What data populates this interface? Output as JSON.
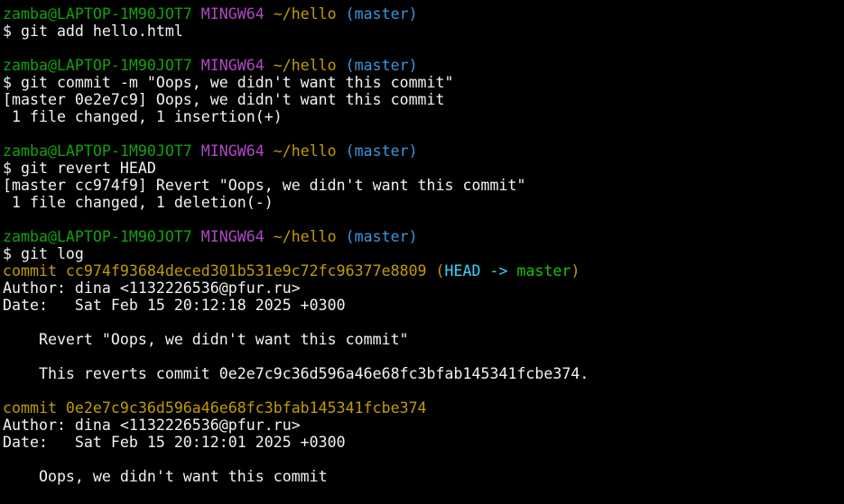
{
  "colors": {
    "background": "#000000",
    "text": "#f2f2f2",
    "prompt_user": "#13a10e",
    "prompt_msys": "#b148c6",
    "prompt_path": "#c19c00",
    "prompt_branch": "#3a96dd",
    "commit_hash": "#c19c00",
    "head_ref": "#3ad5ff",
    "branch_ref": "#16c60c"
  },
  "lines": [
    {
      "type": "prompt",
      "user": "zamba@LAPTOP-1M90JOT7",
      "msys": "MINGW64",
      "path": "~/hello",
      "branch": "(master)"
    },
    {
      "type": "command",
      "text": "$ git add hello.html"
    },
    {
      "type": "blank"
    },
    {
      "type": "prompt",
      "user": "zamba@LAPTOP-1M90JOT7",
      "msys": "MINGW64",
      "path": "~/hello",
      "branch": "(master)"
    },
    {
      "type": "command",
      "text": "$ git commit -m \"Oops, we didn't want this commit\""
    },
    {
      "type": "output",
      "text": "[master 0e2e7c9] Oops, we didn't want this commit"
    },
    {
      "type": "output",
      "text": " 1 file changed, 1 insertion(+)"
    },
    {
      "type": "blank"
    },
    {
      "type": "prompt",
      "user": "zamba@LAPTOP-1M90JOT7",
      "msys": "MINGW64",
      "path": "~/hello",
      "branch": "(master)"
    },
    {
      "type": "command",
      "text": "$ git revert HEAD"
    },
    {
      "type": "output",
      "text": "[master cc974f9] Revert \"Oops, we didn't want this commit\""
    },
    {
      "type": "output",
      "text": " 1 file changed, 1 deletion(-)"
    },
    {
      "type": "blank"
    },
    {
      "type": "prompt",
      "user": "zamba@LAPTOP-1M90JOT7",
      "msys": "MINGW64",
      "path": "~/hello",
      "branch": "(master)"
    },
    {
      "type": "command",
      "text": "$ git log"
    },
    {
      "type": "commit",
      "prefix": "commit cc974f93684deced301b531e9c72fc96377e8809 ",
      "open": "(",
      "head": "HEAD -> ",
      "branch": "master",
      "close": ")"
    },
    {
      "type": "output",
      "text": "Author: dina <1132226536@pfur.ru>"
    },
    {
      "type": "output",
      "text": "Date:   Sat Feb 15 20:12:18 2025 +0300"
    },
    {
      "type": "blank"
    },
    {
      "type": "output",
      "text": "    Revert \"Oops, we didn't want this commit\""
    },
    {
      "type": "blank"
    },
    {
      "type": "output",
      "text": "    This reverts commit 0e2e7c9c36d596a46e68fc3bfab145341fcbe374."
    },
    {
      "type": "blank"
    },
    {
      "type": "commit",
      "prefix": "commit 0e2e7c9c36d596a46e68fc3bfab145341fcbe374"
    },
    {
      "type": "output",
      "text": "Author: dina <1132226536@pfur.ru>"
    },
    {
      "type": "output",
      "text": "Date:   Sat Feb 15 20:12:01 2025 +0300"
    },
    {
      "type": "blank"
    },
    {
      "type": "output",
      "text": "    Oops, we didn't want this commit"
    }
  ]
}
